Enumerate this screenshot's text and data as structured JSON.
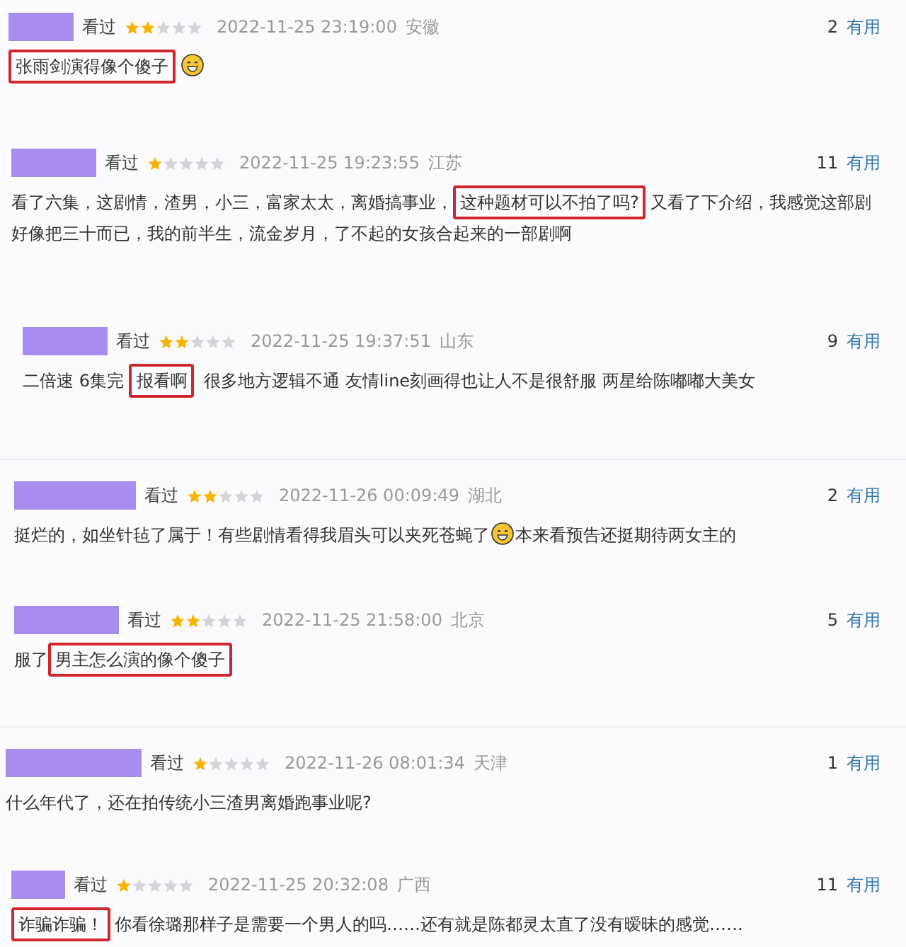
{
  "reviews": [
    {
      "status": "看过",
      "stars": 2,
      "time": "2022-11-25 23:19:00",
      "location": "安徽",
      "votes": "2",
      "vote_label": "有用",
      "body": [
        {
          "kind": "boxed",
          "text": "张雨剑演得像个傻子"
        },
        {
          "kind": "emoji"
        }
      ]
    },
    {
      "status": "看过",
      "stars": 1,
      "time": "2022-11-25 19:23:55",
      "location": "江苏",
      "votes": "11",
      "vote_label": "有用",
      "body": [
        {
          "kind": "text",
          "text": "看了六集，这剧情，渣男，小三，富家太太，离婚搞事业，"
        },
        {
          "kind": "boxed",
          "text": "这种题材可以不拍了吗?"
        },
        {
          "kind": "text",
          "text": "又看了下介绍，我感觉这部剧好像把三十而已，我的前半生，流金岁月，了不起的女孩合起来的一部剧啊"
        }
      ]
    },
    {
      "status": "看过",
      "stars": 2,
      "time": "2022-11-25 19:37:51",
      "location": "山东",
      "votes": "9",
      "vote_label": "有用",
      "body": [
        {
          "kind": "text",
          "text": "二倍速 6集完 "
        },
        {
          "kind": "boxed",
          "text": "报看啊"
        },
        {
          "kind": "text",
          "text": " 很多地方逻辑不通 友情line刻画得也让人不是很舒服 两星给陈嘟嘟大美女"
        }
      ]
    },
    {
      "status": "看过",
      "stars": 2,
      "time": "2022-11-26 00:09:49",
      "location": "湖北",
      "votes": "2",
      "vote_label": "有用",
      "body": [
        {
          "kind": "text",
          "text": "挺烂的，如坐针毡了属于！有些剧情看得我眉头可以夹死苍蝇了"
        },
        {
          "kind": "emoji"
        },
        {
          "kind": "text",
          "text": "本来看预告还挺期待两女主的"
        }
      ]
    },
    {
      "status": "看过",
      "stars": 2,
      "time": "2022-11-25 21:58:00",
      "location": "北京",
      "votes": "5",
      "vote_label": "有用",
      "body": [
        {
          "kind": "text",
          "text": "服了"
        },
        {
          "kind": "boxed",
          "text": "男主怎么演的像个傻子"
        }
      ]
    },
    {
      "status": "看过",
      "stars": 1,
      "time": "2022-11-26 08:01:34",
      "location": "天津",
      "votes": "1",
      "vote_label": "有用",
      "body": [
        {
          "kind": "text",
          "text": "什么年代了，还在拍传统小三渣男离婚跑事业呢?"
        }
      ]
    },
    {
      "status": "看过",
      "stars": 1,
      "time": "2022-11-25 20:32:08",
      "location": "广西",
      "votes": "11",
      "vote_label": "有用",
      "body": [
        {
          "kind": "boxed",
          "text": "诈骗诈骗！"
        },
        {
          "kind": "text",
          "text": "你看徐璐那样子是需要一个男人的吗……还有就是陈都灵太直了没有暧昧的感觉……"
        }
      ]
    }
  ]
}
